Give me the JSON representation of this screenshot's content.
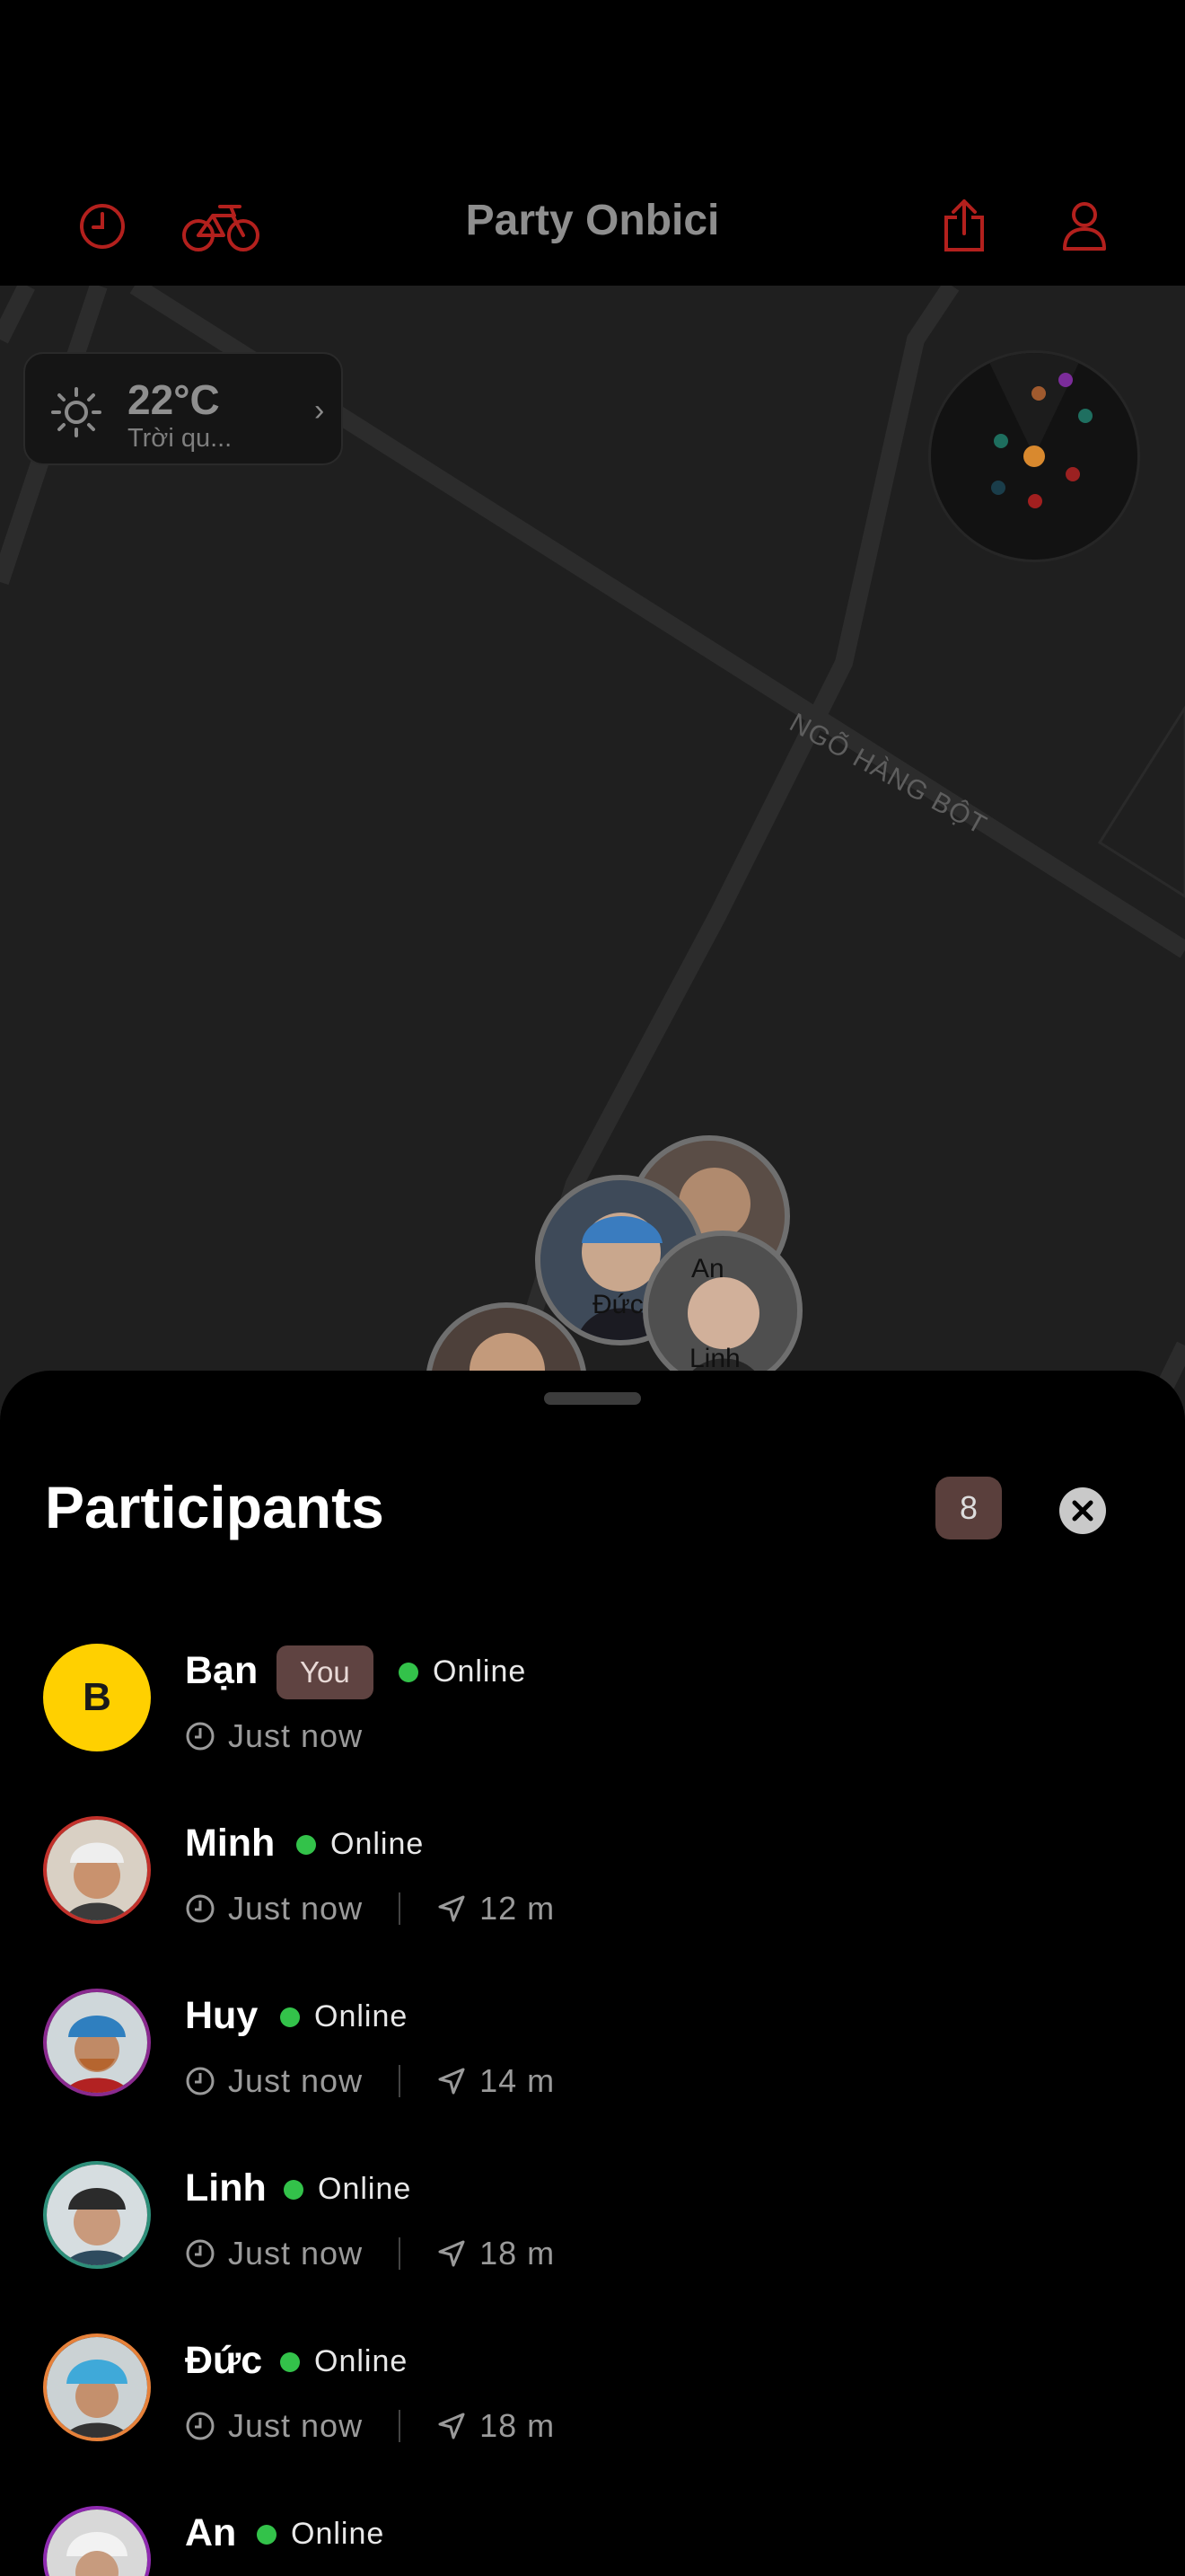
{
  "header": {
    "title": "Party Onbici",
    "left_icons": [
      "history-icon",
      "bicycle-icon"
    ],
    "right_icons": [
      "share-icon",
      "profile-icon"
    ],
    "accent_color": "#b3201d"
  },
  "weather": {
    "temperature": "22°C",
    "description": "Trời qu...",
    "icon": "sun-icon"
  },
  "map": {
    "street_name": "NGÕ HÀNG BỘT",
    "markers": [
      "An",
      "Đức",
      "Linh"
    ]
  },
  "participants": {
    "title": "Participants",
    "count": "8",
    "items": [
      {
        "name": "Bạn",
        "initial": "B",
        "you_label": "You",
        "status": "Online",
        "time": "Just now",
        "distance": "",
        "ring_color": "#ffd000"
      },
      {
        "name": "Minh",
        "status": "Online",
        "time": "Just now",
        "distance": "12 m",
        "ring_color": "#c2312b"
      },
      {
        "name": "Huy",
        "status": "Online",
        "time": "Just now",
        "distance": "14 m",
        "ring_color": "#8a2a8f"
      },
      {
        "name": "Linh",
        "status": "Online",
        "time": "Just now",
        "distance": "18 m",
        "ring_color": "#2e8f7a"
      },
      {
        "name": "Đức",
        "status": "Online",
        "time": "Just now",
        "distance": "18 m",
        "ring_color": "#e6813a"
      },
      {
        "name": "An",
        "status": "Online",
        "time": "",
        "distance": "",
        "ring_color": "#8f2bb0"
      }
    ]
  }
}
